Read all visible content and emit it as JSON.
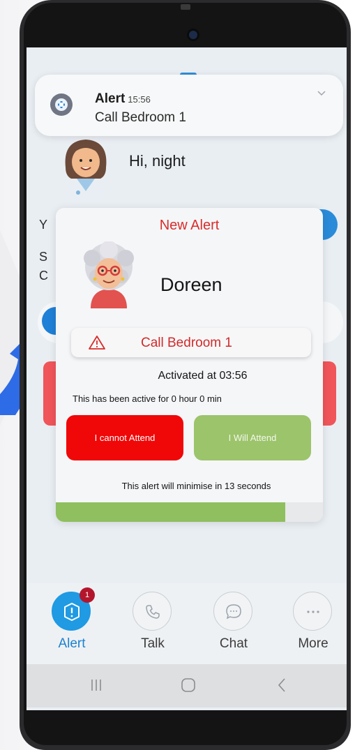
{
  "notification": {
    "app": "Alert",
    "time": "15:56",
    "message": "Call Bedroom 1"
  },
  "home": {
    "greeting": "Hi, night",
    "partial_letters": [
      "Y",
      "S",
      "C"
    ]
  },
  "popup": {
    "title": "New Alert",
    "resident_name": "Doreen",
    "alert_text": "Call Bedroom 1",
    "activated_text": "Activated at 03:56",
    "active_duration_text": "This has been active for 0 hour 0 min",
    "decline_button": "I cannot Attend",
    "accept_button": "I Will Attend",
    "minimise_text": "This alert will minimise in 13 seconds",
    "progress_fraction": 0.86
  },
  "bottom_nav": {
    "items": [
      {
        "label": "Alert",
        "icon": "alert-icon",
        "active": true,
        "badge": "1"
      },
      {
        "label": "Talk",
        "icon": "phone-icon",
        "active": false
      },
      {
        "label": "Chat",
        "icon": "chat-icon",
        "active": false
      },
      {
        "label": "More",
        "icon": "more-icon",
        "active": false
      }
    ]
  },
  "system_nav": [
    "recent-apps-icon",
    "home-icon",
    "back-icon"
  ],
  "colors": {
    "alert_red": "#d92c2c",
    "decline_red": "#f00707",
    "accept_green": "#9cc46b",
    "progress_green": "#8fbf5e",
    "active_blue": "#1f9ae3",
    "badge_red": "#b3162c"
  }
}
